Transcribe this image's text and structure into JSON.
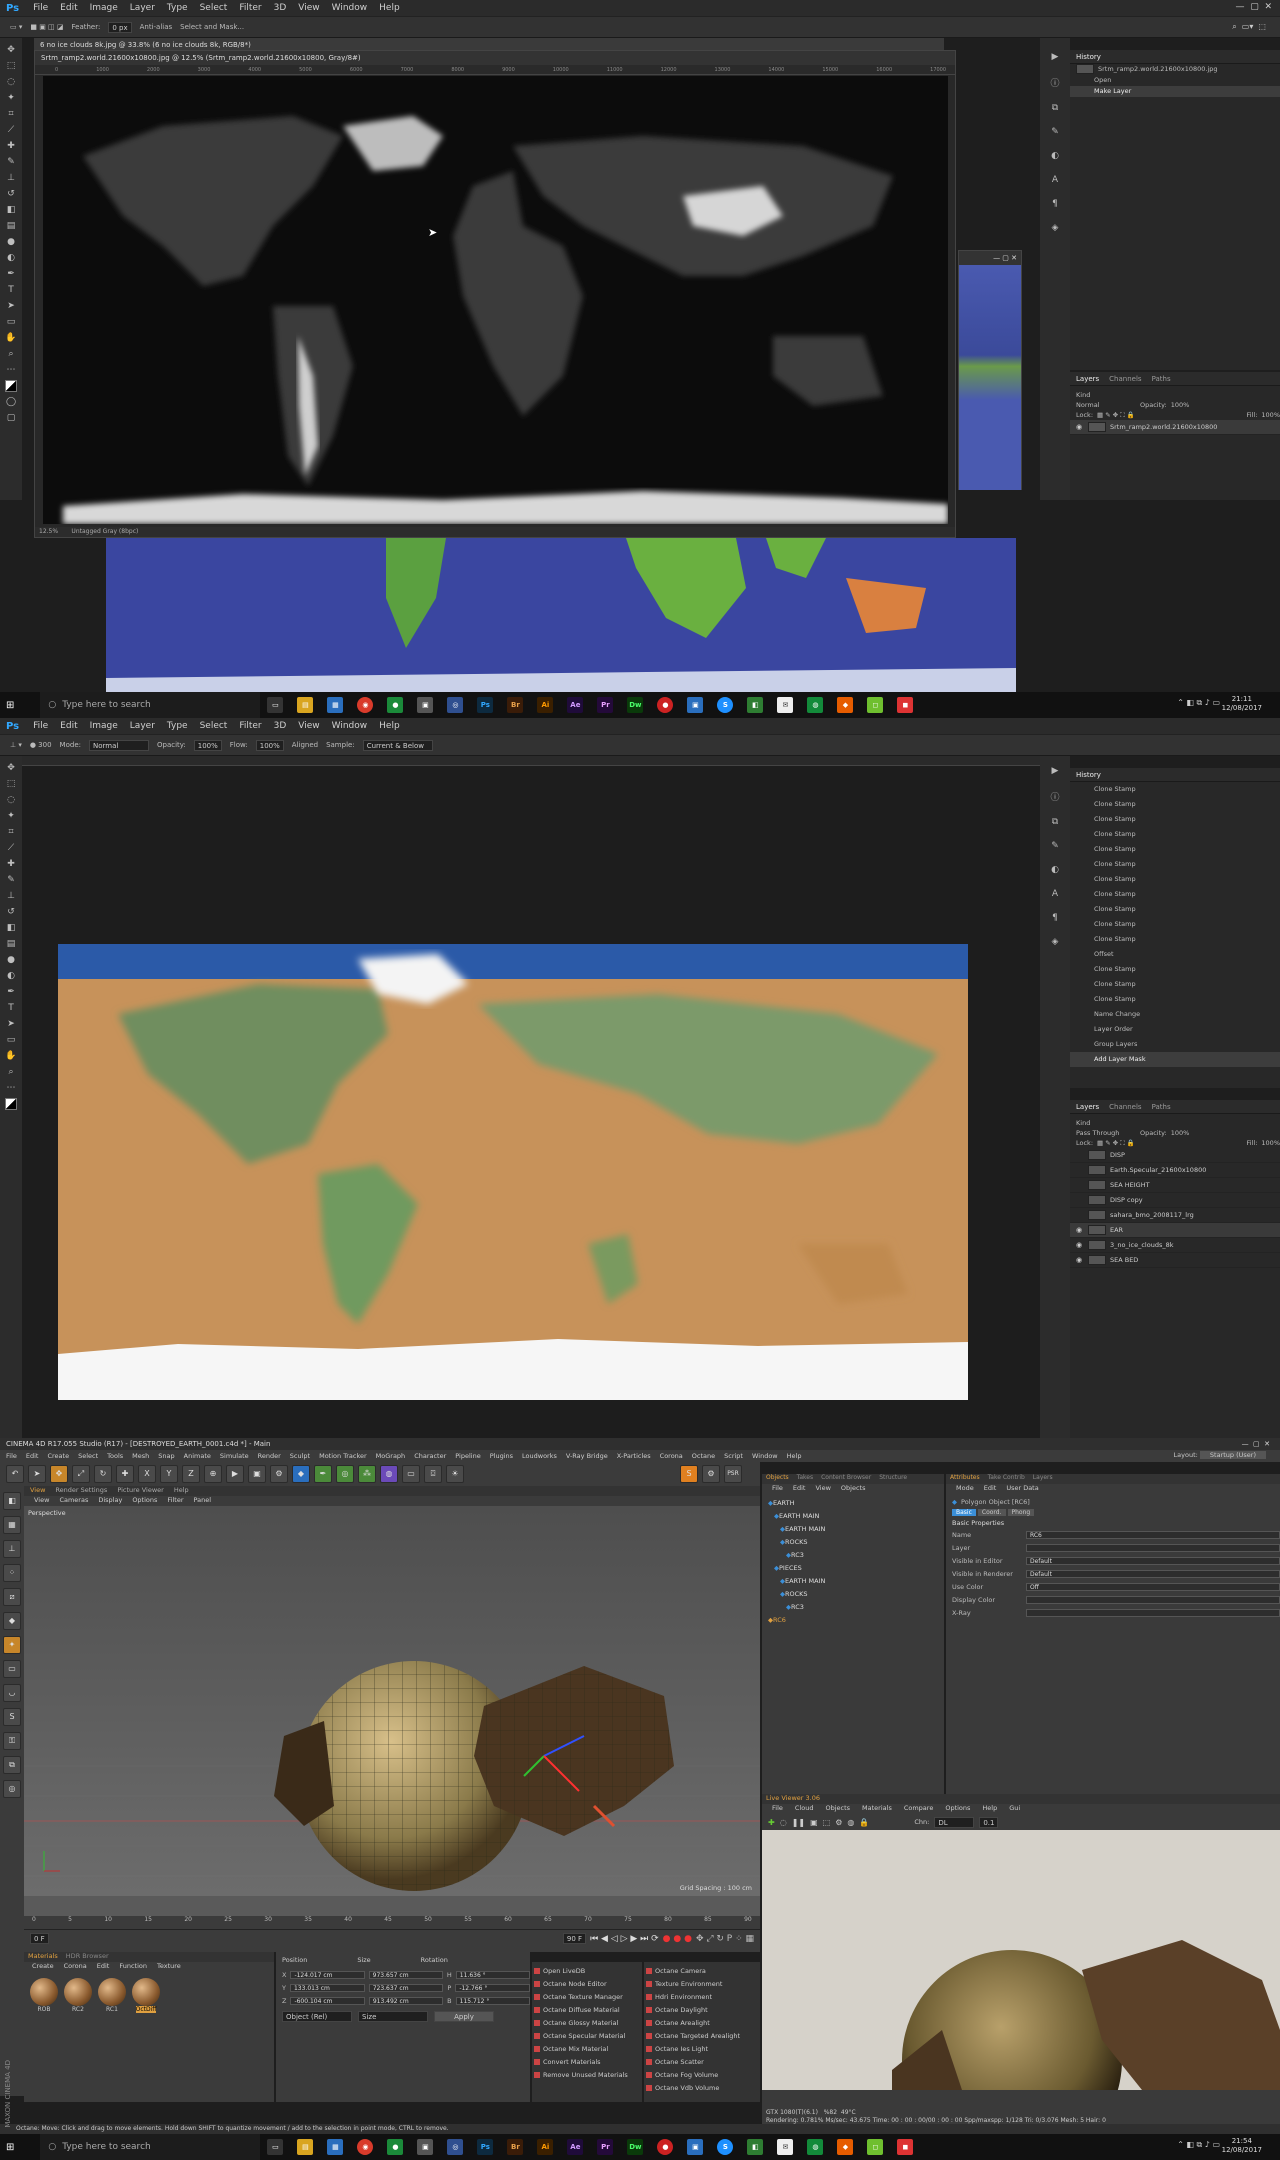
{
  "ps_menu": [
    "File",
    "Edit",
    "Image",
    "Layer",
    "Type",
    "Select",
    "Filter",
    "3D",
    "View",
    "Window",
    "Help"
  ],
  "ps_logo": "Ps",
  "screen1": {
    "options": {
      "feather_label": "Feather:",
      "feather_value": "0 px",
      "antialias": "Anti-alias",
      "select_mask": "Select and Mask..."
    },
    "tab_title": "6 no ice clouds 8k.jpg @ 33.8% (6 no ice clouds 8k, RGB/8*)",
    "doc_title": "Srtm_ramp2.world.21600x10800.jpg @ 12.5% (Srtm_ramp2.world.21600x10800, Gray/8#)",
    "ruler": [
      "0",
      "1000",
      "2000",
      "3000",
      "4000",
      "5000",
      "6000",
      "7000",
      "8000",
      "9000",
      "10000",
      "11000",
      "12000",
      "13000",
      "14000",
      "15000",
      "16000",
      "17000"
    ],
    "status_zoom": "12.5%",
    "status_profile": "Untagged Gray (8bpc)",
    "history_title": "History",
    "history_doc": "Srtm_ramp2.world.21600x10800.jpg",
    "history_items": [
      "Open",
      "Make Layer"
    ],
    "layers_tabs": [
      "Layers",
      "Channels",
      "Paths"
    ],
    "kind": "Kind",
    "blend": "Normal",
    "opacity_label": "Opacity:",
    "opacity": "100%",
    "lock_label": "Lock:",
    "fill_label": "Fill:",
    "fill": "100%",
    "layer_name": "Srtm_ramp2.world.21600x10800"
  },
  "taskbar": {
    "search_placeholder": "Type here to search",
    "time1": "21:11",
    "date1": "12/08/2017",
    "time2": "21:54",
    "date2": "12/08/2017",
    "apps": [
      {
        "label": "Ps",
        "color": "#0d2a3f"
      },
      {
        "label": "Br",
        "color": "#3a1c08"
      },
      {
        "label": "Ai",
        "color": "#3a1f00"
      },
      {
        "label": "Ae",
        "color": "#1f0b3a"
      },
      {
        "label": "Pr",
        "color": "#240a3a"
      },
      {
        "label": "Dw",
        "color": "#0a3a0a"
      }
    ]
  },
  "screen2": {
    "options": {
      "mode_label": "Mode:",
      "mode": "Normal",
      "opacity_label": "Opacity:",
      "opacity": "100%",
      "flow_label": "Flow:",
      "flow": "100%",
      "aligned": "Aligned",
      "sample_label": "Sample:",
      "sample": "Current & Below"
    },
    "history_title": "History",
    "history_items": [
      "Clone Stamp",
      "Clone Stamp",
      "Clone Stamp",
      "Clone Stamp",
      "Clone Stamp",
      "Clone Stamp",
      "Clone Stamp",
      "Clone Stamp",
      "Clone Stamp",
      "Clone Stamp",
      "Clone Stamp",
      "Offset",
      "Clone Stamp",
      "Clone Stamp",
      "Clone Stamp",
      "Name Change",
      "Layer Order",
      "Group Layers",
      "Add Layer Mask"
    ],
    "layers_tabs": [
      "Layers",
      "Channels",
      "Paths"
    ],
    "kind": "Kind",
    "blend": "Pass Through",
    "opacity_label": "Opacity:",
    "opacity": "100%",
    "lock_label": "Lock:",
    "fill_label": "Fill:",
    "fill": "100%",
    "layers": [
      "DISP",
      "Earth.Specular_21600x10800",
      "SEA HEIGHT",
      "DISP copy",
      "sahara_bmo_2008117_lrg",
      "EAR",
      "3_no_ice_clouds_8k",
      "SEA BED"
    ]
  },
  "c4d": {
    "title": "CINEMA 4D R17.055 Studio (R17) - [DESTROYED_EARTH_0001.c4d *] - Main",
    "layout_label": "Layout:",
    "layout": "Startup (User)",
    "menu": [
      "File",
      "Edit",
      "Create",
      "Select",
      "Tools",
      "Mesh",
      "Snap",
      "Animate",
      "Simulate",
      "Render",
      "Sculpt",
      "Motion Tracker",
      "MoGraph",
      "Character",
      "Pipeline",
      "Plugins",
      "Loudworks",
      "V-Ray Bridge",
      "X-Particles",
      "Corona",
      "Octane",
      "Script",
      "Window",
      "Help"
    ],
    "viewport_menu": [
      "View",
      "Cameras",
      "Display",
      "Options",
      "Filter",
      "Panel"
    ],
    "viewport_tabs": [
      "View",
      "Render Settings",
      "Picture Viewer",
      "Help"
    ],
    "viewport_label": "Perspective",
    "grid_spacing": "Grid Spacing : 100 cm",
    "obj_tabs": [
      "Objects",
      "Takes",
      "Content Browser",
      "Structure"
    ],
    "obj_menu": [
      "File",
      "Edit",
      "View",
      "Objects"
    ],
    "objects": [
      "EARTH",
      "EARTH MAIN",
      "EARTH MAIN",
      "ROCKS",
      "RC3",
      "PIECES",
      "EARTH MAIN",
      "ROCKS",
      "RC3",
      "RC6"
    ],
    "attr_tabs": [
      "Attributes",
      "Take Contrib",
      "Layers"
    ],
    "attr_menu": [
      "Mode",
      "Edit",
      "User Data"
    ],
    "attr_object": "Polygon Object [RC6]",
    "attr_subtabs": [
      "Basic",
      "Coord.",
      "Phong"
    ],
    "basic_props": "Basic Properties",
    "attrs": [
      {
        "label": "Name",
        "value": "RC6"
      },
      {
        "label": "Layer",
        "value": ""
      },
      {
        "label": "Visible in Editor",
        "value": "Default"
      },
      {
        "label": "Visible in Renderer",
        "value": "Default"
      },
      {
        "label": "Use Color",
        "value": "Off"
      },
      {
        "label": "Display Color",
        "value": ""
      },
      {
        "label": "X-Ray",
        "value": ""
      }
    ],
    "live_viewer_title": "Live Viewer 3.06",
    "live_menu": [
      "File",
      "Cloud",
      "Objects",
      "Materials",
      "Compare",
      "Options",
      "Help",
      "Gui"
    ],
    "chn_label": "Chn:",
    "chn": "DL",
    "chn_value": "0.1",
    "rendering_info": "Rendering: 0.781%  Ms/sec: 43.675  Time: 00 : 00 : 00/00 : 00 : 00  Spp/maxspp: 1/128  Tri: 0/3.076  Mesh: 5  Hair: 0",
    "gpu_info": "GTX 1080(T)(6.1)",
    "gpu_pct": "%82",
    "gpu_temp": "49°C",
    "timeline_ticks": [
      "0",
      "5",
      "10",
      "15",
      "20",
      "25",
      "30",
      "35",
      "40",
      "45",
      "50",
      "55",
      "60",
      "65",
      "70",
      "75",
      "80",
      "85",
      "90"
    ],
    "frame_start": "0 F",
    "frame_end": "90 F",
    "materials_tabs": [
      "Materials",
      "HDR Browser"
    ],
    "materials_menu": [
      "Create",
      "Corona",
      "Edit",
      "Function",
      "Texture"
    ],
    "materials": [
      "ROB",
      "RC2",
      "RC1",
      "OctDiff"
    ],
    "coord_headers": [
      "Position",
      "Size",
      "Rotation"
    ],
    "coords": [
      {
        "axis": "X",
        "pos": "-124.017 cm",
        "size": "973.657 cm",
        "rot_label": "H",
        "rot": "11.636 °"
      },
      {
        "axis": "Y",
        "pos": "133.013 cm",
        "size": "723.637 cm",
        "rot_label": "P",
        "rot": "-12.766 °"
      },
      {
        "axis": "Z",
        "pos": "-600.104 cm",
        "size": "913.492 cm",
        "rot_label": "B",
        "rot": "115.712 °"
      }
    ],
    "coord_mode": "Object (Rel)",
    "size_mode": "Size",
    "apply": "Apply",
    "octane_left": [
      "Open LiveDB",
      "Octane Node Editor",
      "Octane Texture Manager",
      "Octane Diffuse Material",
      "Octane Glossy Material",
      "Octane Specular Material",
      "Octane Mix Material",
      "Convert Materials",
      "Remove Unused Materials"
    ],
    "octane_right": [
      "Octane Camera",
      "Texture Environment",
      "Hdri Environment",
      "Octane Daylight",
      "Octane Arealight",
      "Octane Targeted Arealight",
      "Octane Ies Light",
      "Octane Scatter",
      "Octane Fog Volume",
      "Octane Vdb Volume"
    ],
    "status": "Octane:   Move: Click and drag to move elements. Hold down SHIFT to quantize movement / add to the selection in point mode, CTRL to remove.",
    "maxon": "MAXON CINEMA 4D"
  }
}
